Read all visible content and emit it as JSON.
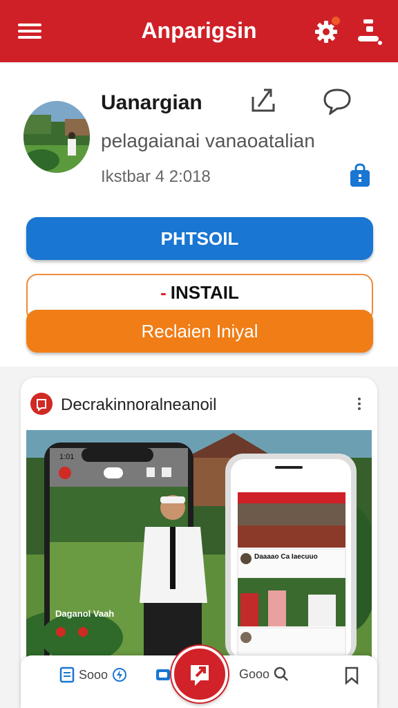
{
  "header": {
    "title": "Anparigsin",
    "menu_icon": "hamburger-menu-icon",
    "settings_icon": "gear-icon",
    "profile_icon": "person-icon"
  },
  "profile": {
    "name": "Uanargian",
    "handle": "pelagaianai vanaoatalian",
    "meta": "Ikstbar 4 2:018",
    "avatar": "avatar-photo",
    "share_icon": "share-icon",
    "chat_icon": "chat-bubble-icon",
    "bag_icon": "shopping-bag-icon"
  },
  "buttons": {
    "primary": "PHTSOIL",
    "install_dash": "-",
    "install": "INSTAIL",
    "orange": "Reclaien Iniyal"
  },
  "post": {
    "title": "Decrakinnoralneanoil",
    "photo_caption": "Daganol Vaah",
    "phone_time": "1:01",
    "feed_item": "Daaaao Ca Iaecuuo"
  },
  "bottom_nav": {
    "item1_label": "Sooo",
    "item3_label": "Gooo"
  },
  "colors": {
    "brand_red": "#cf2027",
    "primary_blue": "#1976d2",
    "accent_orange": "#f07d16"
  }
}
